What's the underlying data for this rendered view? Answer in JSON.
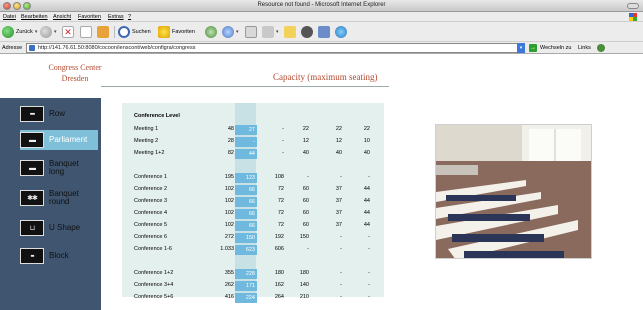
{
  "window": {
    "title": "Resource not found - Microsoft Internet Explorer"
  },
  "menu": {
    "items": [
      "Datei",
      "Bearbeiten",
      "Ansicht",
      "Favoriten",
      "Extras",
      "?"
    ]
  },
  "toolbar": {
    "back": "Zurück",
    "search": "Suchen",
    "favorites": "Favoriten"
  },
  "address": {
    "label": "Adresse",
    "url": "http://141.76.61.50:8080/cocoon/ienscont/web/configra/congress",
    "go": "Wechseln zu",
    "links": "Links"
  },
  "site": {
    "brand_line1": "Congress Center",
    "brand_line2": "Dresden",
    "page_title": "Capacity (maximum seating)"
  },
  "nav": [
    {
      "label": "Row",
      "active": false
    },
    {
      "label": "Parliament",
      "active": true
    },
    {
      "label": "Banquet long",
      "active": false
    },
    {
      "label": "Banquet round",
      "active": false
    },
    {
      "label": "U Shape",
      "active": false
    },
    {
      "label": "Block",
      "active": false
    }
  ],
  "table": {
    "section_title": "Conference Level",
    "rows": [
      [
        "Meeting 1",
        "48",
        "27",
        "-",
        "22",
        "22",
        "22"
      ],
      [
        "Meeting 2",
        "28",
        "-",
        "-",
        "12",
        "12",
        "10"
      ],
      [
        "Meeting 1+2",
        "82",
        "44",
        "-",
        "40",
        "40",
        "40"
      ],
      null,
      [
        "Conference 1",
        "195",
        "123",
        "108",
        "-",
        "-",
        "-"
      ],
      [
        "Conference 2",
        "102",
        "66",
        "72",
        "60",
        "37",
        "44"
      ],
      [
        "Conference 3",
        "102",
        "66",
        "72",
        "60",
        "37",
        "44"
      ],
      [
        "Conference 4",
        "102",
        "66",
        "72",
        "60",
        "37",
        "44"
      ],
      [
        "Conference 5",
        "102",
        "66",
        "72",
        "60",
        "37",
        "44"
      ],
      [
        "Conference 6",
        "272",
        "150",
        "192",
        "150",
        "-",
        "-"
      ],
      [
        "Conference 1-6",
        "1.033",
        "623",
        "606",
        "-",
        "-",
        "-"
      ],
      null,
      [
        "Conference 1+2",
        "355",
        "228",
        "180",
        "180",
        "-",
        "-"
      ],
      [
        "Conference 3+4",
        "262",
        "171",
        "162",
        "140",
        "-",
        "-"
      ],
      [
        "Conference 5+6",
        "416",
        "224",
        "264",
        "210",
        "-",
        "-"
      ]
    ]
  }
}
